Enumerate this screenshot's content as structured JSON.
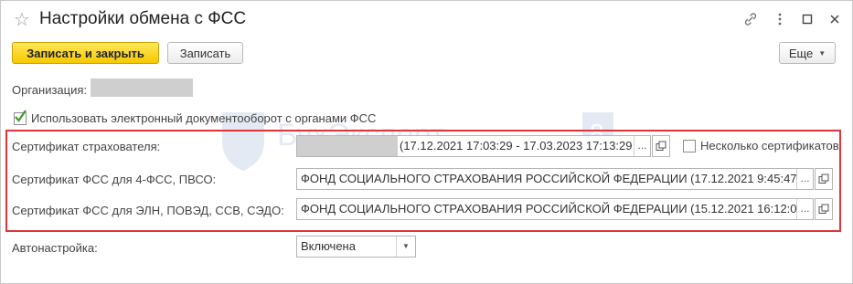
{
  "window": {
    "title": "Настройки обмена с ФСС"
  },
  "toolbar": {
    "save_close_label": "Записать и закрыть",
    "save_label": "Записать",
    "more_label": "Еще"
  },
  "form": {
    "organization_label": "Организация:",
    "edo_checkbox_label": "Использовать электронный документооборот с органами ФСС",
    "insurer_cert_label": "Сертификат страхователя:",
    "insurer_cert_value": "(17.12.2021 17:03:29 - 17.03.2023 17:13:29",
    "multi_cert_label": "Несколько сертификатов",
    "fss_cert_4fss_label": "Сертификат ФСС для 4-ФСС, ПВСО:",
    "fss_cert_4fss_value": "ФОНД СОЦИАЛЬНОГО СТРАХОВАНИЯ РОССИЙСКОЙ ФЕДЕРАЦИИ (17.12.2021 9:45:47",
    "fss_cert_eln_label": "Сертификат ФСС для ЭЛН, ПОВЭД, ССВ, СЭДО:",
    "fss_cert_eln_value": "ФОНД СОЦИАЛЬНОГО СТРАХОВАНИЯ РОССИЙСКОЙ ФЕДЕРАЦИИ (15.12.2021 16:12:0",
    "autosetup_label": "Автонастройка:",
    "autosetup_value": "Включена"
  },
  "watermark": {
    "text": "БухЭксперт",
    "digit": "8"
  },
  "colors": {
    "accent_yellow": "#f5c900",
    "highlight_red": "#e0333a",
    "checkbox_green": "#3a9a2a"
  }
}
